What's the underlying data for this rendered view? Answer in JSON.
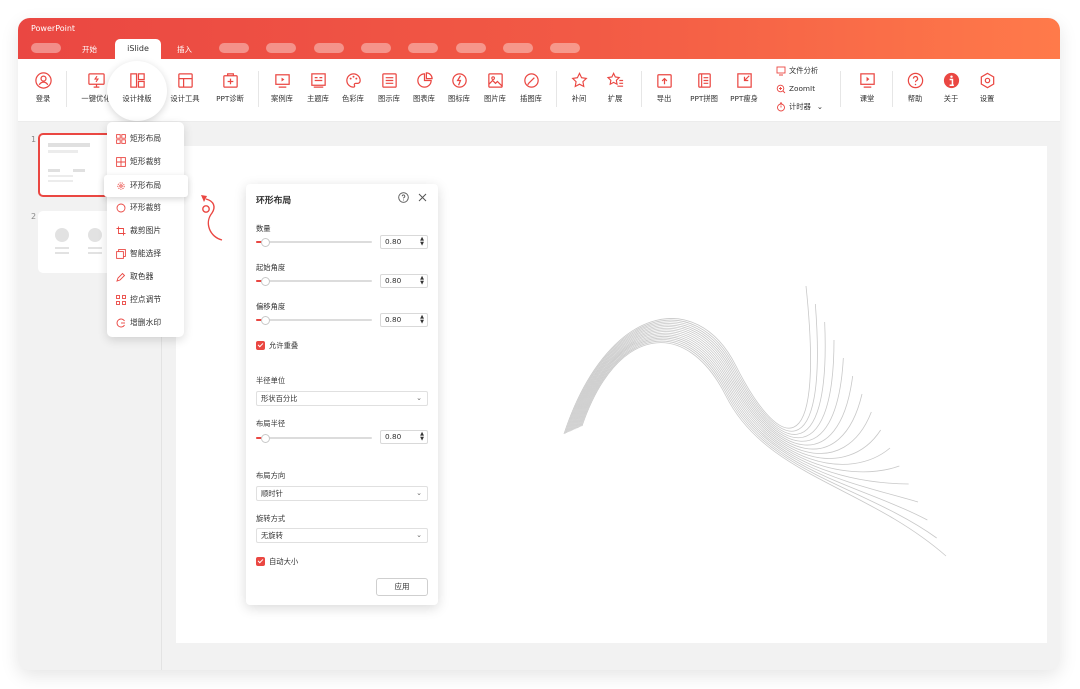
{
  "app": {
    "title": "PowerPoint"
  },
  "tabs": [
    {
      "label": ""
    },
    {
      "label": "开始"
    },
    {
      "label": "iSlide"
    },
    {
      "label": "插入"
    }
  ],
  "ribbon": {
    "login": "登录",
    "one_click": "一键优化",
    "design_layout": "设计排版",
    "design_tools": "设计工具",
    "ppt_diag": "PPT诊断",
    "cases": "案例库",
    "themes": "主题库",
    "colors": "色彩库",
    "diagrams": "图示库",
    "charts": "图表库",
    "icons": "图标库",
    "pictures": "图片库",
    "illustrations": "插图库",
    "tween": "补间",
    "expand": "扩展",
    "export": "导出",
    "ppt_merge": "PPT拼图",
    "ppt_slim": "PPT瘦身",
    "file_analysis": "文件分析",
    "zoomit": "ZoomIt",
    "timer": "计时器",
    "classroom": "课堂",
    "help": "帮助",
    "about": "关于",
    "settings": "设置"
  },
  "thumbnails": [
    {
      "num": "1"
    },
    {
      "num": "2"
    }
  ],
  "dropdown": {
    "items": [
      {
        "label": "矩形布局",
        "icon": "grid-icon"
      },
      {
        "label": "矩形裁剪",
        "icon": "grid-crop-icon"
      },
      {
        "label": "环形布局",
        "icon": "ring-layout-icon"
      },
      {
        "label": "环形裁剪",
        "icon": "ring-crop-icon"
      },
      {
        "label": "裁剪图片",
        "icon": "crop-icon"
      },
      {
        "label": "智能选择",
        "icon": "smart-select-icon"
      },
      {
        "label": "取色器",
        "icon": "eyedropper-icon"
      },
      {
        "label": "控点调节",
        "icon": "control-points-icon"
      },
      {
        "label": "增删水印",
        "icon": "watermark-icon"
      }
    ]
  },
  "panel": {
    "title": "环形布局",
    "count_label": "数量",
    "count_value": "0.80",
    "count_level": 0.08,
    "start_angle_label": "起始角度",
    "start_angle_value": "0.80",
    "start_angle_level": 0.08,
    "offset_angle_label": "偏移角度",
    "offset_angle_value": "0.80",
    "offset_angle_level": 0.08,
    "allow_overlap": "允许重叠",
    "radius_unit_label": "半径单位",
    "radius_unit_value": "形状百分比",
    "layout_radius_label": "布局半径",
    "layout_radius_value": "0.80",
    "layout_radius_level": 0.08,
    "direction_label": "布局方向",
    "direction_value": "顺时针",
    "rotation_label": "旋转方式",
    "rotation_value": "无旋转",
    "auto_size": "自动大小",
    "apply": "应用"
  },
  "colors": {
    "accent": "#ea4742",
    "title_gradient_end": "#ff7a4a"
  }
}
